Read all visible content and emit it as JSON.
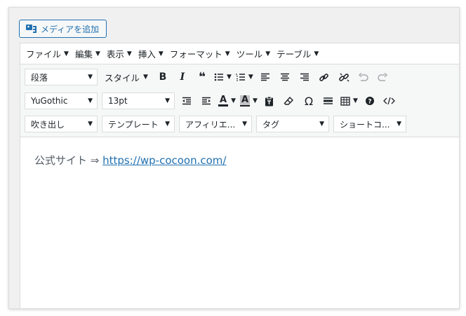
{
  "media_button": {
    "label": "メディアを追加",
    "icon": "media-icon"
  },
  "menubar": [
    "ファイル",
    "編集",
    "表示",
    "挿入",
    "フォーマット",
    "ツール",
    "テーブル"
  ],
  "toolbar": {
    "row1": {
      "block_format": "段落",
      "style_label": "スタイル",
      "buttons": [
        "bold-icon",
        "italic-icon",
        "blockquote-icon",
        "bullet-list-icon",
        "numbered-list-icon",
        "align-left-icon",
        "align-center-icon",
        "align-right-icon",
        "link-icon",
        "unlink-icon",
        "undo-icon",
        "redo-icon"
      ]
    },
    "row2": {
      "font_family": "YuGothic",
      "font_size": "13pt",
      "buttons": [
        "outdent-icon",
        "indent-icon",
        "text-color-icon",
        "background-color-icon",
        "paste-text-icon",
        "clear-format-icon",
        "special-character-icon",
        "horizontal-rule-icon",
        "table-icon",
        "help-icon",
        "code-icon"
      ]
    },
    "row3": {
      "balloon": "吹き出し",
      "template": "テンプレート",
      "affiliate": "アフィリエ...",
      "tag": "タグ",
      "shortcode": "ショートコ..."
    }
  },
  "content": {
    "prefix": "公式サイト ⇒ ",
    "link_text": "https://wp-cocoon.com/"
  }
}
